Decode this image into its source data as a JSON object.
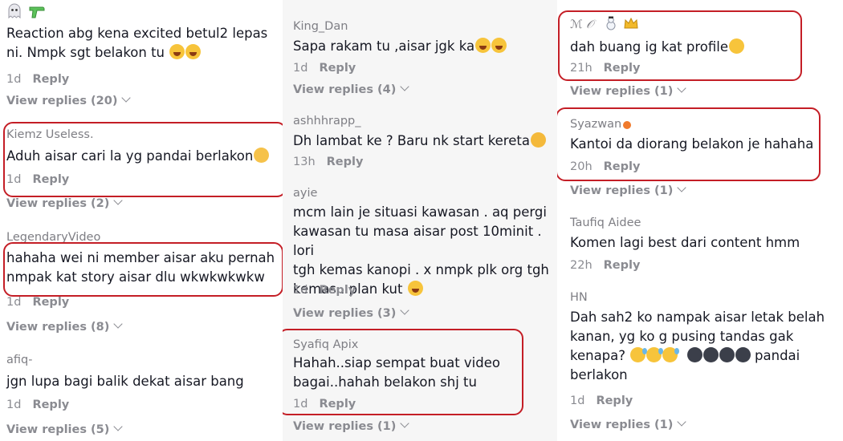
{
  "col1": [
    {
      "user_icons": [
        "ghost-icon",
        "water-gun-icon"
      ],
      "text_lines": [
        "Reaction abg kena excited betul2 lepas",
        "ni. Nmpk sgt belakon tu"
      ],
      "time": "1d",
      "reply": "Reply",
      "view": "View replies (20)"
    },
    {
      "user": "Kiemz Useless.",
      "text_lines": [
        "Aduh aisar cari la yg pandai berlakon"
      ],
      "time": "1d",
      "reply": "Reply",
      "view": "View replies (2)"
    },
    {
      "user": "LegendaryVideo",
      "text_lines": [
        "hahaha wei ni member aisar aku pernah",
        "nmpak kat story aisar dlu wkwkwkwkw"
      ],
      "time": "1d",
      "reply": "Reply",
      "view": "View replies (8)"
    },
    {
      "user": "afiq-",
      "text_lines": [
        "jgn lupa bagi balik dekat aisar bang"
      ],
      "time": "1d",
      "reply": "Reply",
      "view": "View replies (5)"
    }
  ],
  "col2": [
    {
      "user": "King_Dan",
      "text_lines": [
        "Sapa rakam tu ,aisar jgk ka"
      ],
      "time": "1d",
      "reply": "Reply",
      "view": "View replies (4)"
    },
    {
      "user": "ashhhrapp_",
      "text_lines": [
        "Dh lambat ke ? Baru nk start kereta"
      ],
      "time": "13h",
      "reply": "Reply"
    },
    {
      "user": "ayie",
      "text_lines": [
        "mcm lain je situasi kawasan . aq pergi",
        "kawasan tu masa aisar post 10minit . lori",
        "tgh kemas kanopi . x nmpk plk org tgh",
        "kemas . plan kut"
      ],
      "time": "1d",
      "reply": "Reply",
      "view": "View replies (3)"
    },
    {
      "user": "Syafiq Apix",
      "text_lines": [
        "Hahah..siap sempat buat video",
        "bagai..hahah belakon shj tu"
      ],
      "time": "1d",
      "reply": "Reply",
      "view": "View replies (1)"
    }
  ],
  "col3": [
    {
      "user": "ℳ 𝒪",
      "text_lines": [
        "dah buang ig kat profile"
      ],
      "time": "21h",
      "reply": "Reply",
      "view": "View replies (1)"
    },
    {
      "user": "Syazwan",
      "text_lines": [
        "Kantoi da diorang belakon je hahaha"
      ],
      "time": "20h",
      "reply": "Reply",
      "view": "View replies (1)"
    },
    {
      "user": "Taufiq Aidee",
      "text_lines": [
        "Komen lagi best dari content hmm"
      ],
      "time": "22h",
      "reply": "Reply"
    },
    {
      "user": "HN",
      "text_lines": [
        "Dah sah2 ko nampak aisar letak belah",
        "kanan, yg ko g pusing tandas gak",
        "kenapa?",
        "pandai",
        "berlakon"
      ],
      "time": "1d",
      "reply": "Reply",
      "view": "View replies (1)"
    }
  ]
}
